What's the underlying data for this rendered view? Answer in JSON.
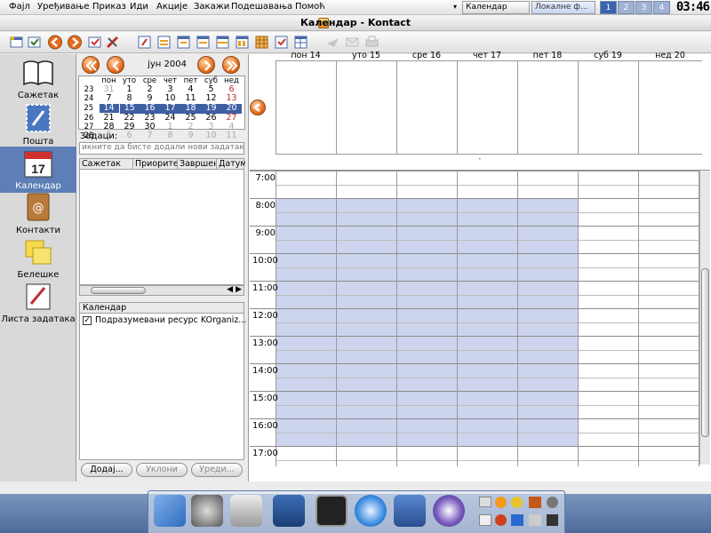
{
  "menubar": {
    "items": [
      "Фајл",
      "Уређивање",
      "Приказ",
      "Иди",
      "Акције",
      "Закажи",
      "Подешавања",
      "Помоћ"
    ],
    "task_active": "Календар",
    "task_other": "Локалне ф...",
    "desktops": [
      "1",
      "2",
      "3",
      "4"
    ],
    "clock": "03:46"
  },
  "window": {
    "title": "Календар - Kontact"
  },
  "sidebar": {
    "items": [
      {
        "label": "Сажетак"
      },
      {
        "label": "Пошта"
      },
      {
        "label": "Календар",
        "badge": "17"
      },
      {
        "label": "Контакти"
      },
      {
        "label": "Белешке"
      },
      {
        "label": "Листа задатака"
      }
    ]
  },
  "datenav": {
    "month_label": "јун 2004"
  },
  "minical": {
    "weekdays": [
      "пон",
      "уто",
      "сре",
      "чет",
      "пет",
      "суб",
      "нед"
    ],
    "weeks": [
      {
        "wk": "23",
        "days": [
          "31",
          "1",
          "2",
          "3",
          "4",
          "5",
          "6"
        ]
      },
      {
        "wk": "24",
        "days": [
          "7",
          "8",
          "9",
          "10",
          "11",
          "12",
          "13"
        ]
      },
      {
        "wk": "25",
        "days": [
          "14",
          "15",
          "16",
          "17",
          "18",
          "19",
          "20"
        ]
      },
      {
        "wk": "26",
        "days": [
          "21",
          "22",
          "23",
          "24",
          "25",
          "26",
          "27"
        ]
      },
      {
        "wk": "27",
        "days": [
          "28",
          "29",
          "30",
          "1",
          "2",
          "3",
          "4"
        ]
      },
      {
        "wk": "28",
        "days": [
          "5",
          "6",
          "7",
          "8",
          "9",
          "10",
          "11"
        ]
      }
    ]
  },
  "tasks": {
    "label": "Задаци:",
    "placeholder": "икните да бисте додали нови задатак",
    "columns": [
      "Сажетак",
      "Приорите",
      "Завршен",
      "Датум"
    ]
  },
  "resources": {
    "header": "Календар",
    "items": [
      {
        "label": "Подразумевани ресурс KOrganiz...",
        "checked": "✓"
      }
    ],
    "buttons": {
      "add": "Додај...",
      "remove": "Уклони",
      "edit": "Уреди..."
    }
  },
  "agenda": {
    "days": [
      "пон 14",
      "уто 15",
      "сре 16",
      "чет 17",
      "пет 18",
      "суб 19",
      "нед 20"
    ],
    "hours": [
      "7:00",
      "8:00",
      "9:00",
      "10:00",
      "11:00",
      "12:00",
      "13:00",
      "14:00",
      "15:00",
      "16:00",
      "17:00"
    ]
  },
  "colors": {
    "accent": "#5d7eb6",
    "workhours": "#ccd5ed",
    "weekend": "#c62828"
  }
}
